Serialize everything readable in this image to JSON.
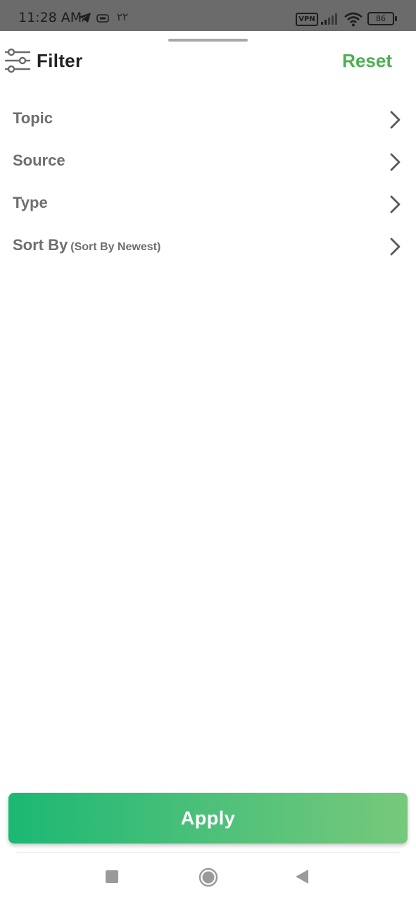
{
  "status_bar": {
    "time": "11:28 AM",
    "arabic_text": "۲۲",
    "vpn_label": "VPN",
    "battery": "86"
  },
  "header": {
    "title": "Filter",
    "reset_label": "Reset",
    "accent_color": "#4caf50"
  },
  "filters": [
    {
      "label": "Topic",
      "sub": ""
    },
    {
      "label": "Source",
      "sub": ""
    },
    {
      "label": "Type",
      "sub": ""
    },
    {
      "label": "Sort By",
      "sub": "(Sort By Newest)"
    }
  ],
  "apply_label": "Apply",
  "icons": {
    "header": "sliders-icon",
    "row_chevron": "chevron-right-icon",
    "nav": [
      "recent-apps-icon",
      "home-icon",
      "back-icon"
    ]
  }
}
